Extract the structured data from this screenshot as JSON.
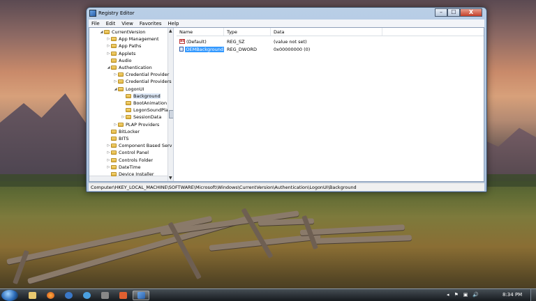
{
  "window": {
    "title": "Registry Editor",
    "buttons": {
      "minimize": "–",
      "maximize": "☐",
      "close": "X"
    }
  },
  "menu": [
    "File",
    "Edit",
    "View",
    "Favorites",
    "Help"
  ],
  "tree": [
    {
      "label": "CurrentVersion",
      "depth": 0,
      "toggle": "◢",
      "state": "expanded"
    },
    {
      "label": "App Management",
      "depth": 1,
      "toggle": "▷",
      "state": "collapsed"
    },
    {
      "label": "App Paths",
      "depth": 1,
      "toggle": "▷",
      "state": "collapsed"
    },
    {
      "label": "Applets",
      "depth": 1,
      "toggle": "▷",
      "state": "collapsed"
    },
    {
      "label": "Audio",
      "depth": 1,
      "toggle": "",
      "state": "leaf"
    },
    {
      "label": "Authentication",
      "depth": 1,
      "toggle": "◢",
      "state": "expanded"
    },
    {
      "label": "Credential Provider",
      "depth": 2,
      "toggle": "▷",
      "state": "collapsed"
    },
    {
      "label": "Credential Providers",
      "depth": 2,
      "toggle": "▷",
      "state": "collapsed"
    },
    {
      "label": "LogonUI",
      "depth": 2,
      "toggle": "◢",
      "state": "expanded"
    },
    {
      "label": "Background",
      "depth": 3,
      "toggle": "",
      "state": "selected"
    },
    {
      "label": "BootAnimation",
      "depth": 3,
      "toggle": "",
      "state": "leaf"
    },
    {
      "label": "LogonSoundPla",
      "depth": 3,
      "toggle": "",
      "state": "leaf"
    },
    {
      "label": "SessionData",
      "depth": 3,
      "toggle": "▷",
      "state": "collapsed"
    },
    {
      "label": "PLAP Providers",
      "depth": 2,
      "toggle": "▷",
      "state": "collapsed"
    },
    {
      "label": "BitLocker",
      "depth": 1,
      "toggle": "",
      "state": "leaf"
    },
    {
      "label": "BITS",
      "depth": 1,
      "toggle": "",
      "state": "leaf"
    },
    {
      "label": "Component Based Serv",
      "depth": 1,
      "toggle": "▷",
      "state": "collapsed"
    },
    {
      "label": "Control Panel",
      "depth": 1,
      "toggle": "▷",
      "state": "collapsed"
    },
    {
      "label": "Controls Folder",
      "depth": 1,
      "toggle": "▷",
      "state": "collapsed"
    },
    {
      "label": "DateTime",
      "depth": 1,
      "toggle": "▷",
      "state": "collapsed"
    },
    {
      "label": "Device Installer",
      "depth": 1,
      "toggle": "",
      "state": "leaf"
    }
  ],
  "list": {
    "headers": {
      "name": "Name",
      "type": "Type",
      "data": "Data"
    },
    "rows": [
      {
        "name": "(Default)",
        "type": "REG_SZ",
        "data": "(value not set)",
        "icon": "string-value-icon",
        "selected": false
      },
      {
        "name": "OEMBackground",
        "type": "REG_DWORD",
        "data": "0x00000000 (0)",
        "icon": "binary-value-icon",
        "selected": true
      }
    ]
  },
  "status": "Computer\\HKEY_LOCAL_MACHINE\\SOFTWARE\\Microsoft\\Windows\\CurrentVersion\\Authentication\\LogonUI\\Background",
  "taskbar": {
    "apps": [
      "explorer-icon",
      "firefox-icon",
      "network-icon",
      "ie-icon",
      "wireless-icon",
      "app-icon",
      "regedit-icon"
    ],
    "tray": [
      "◂",
      "⚑",
      "▣",
      "🔊"
    ],
    "clock": "8:34 PM"
  }
}
